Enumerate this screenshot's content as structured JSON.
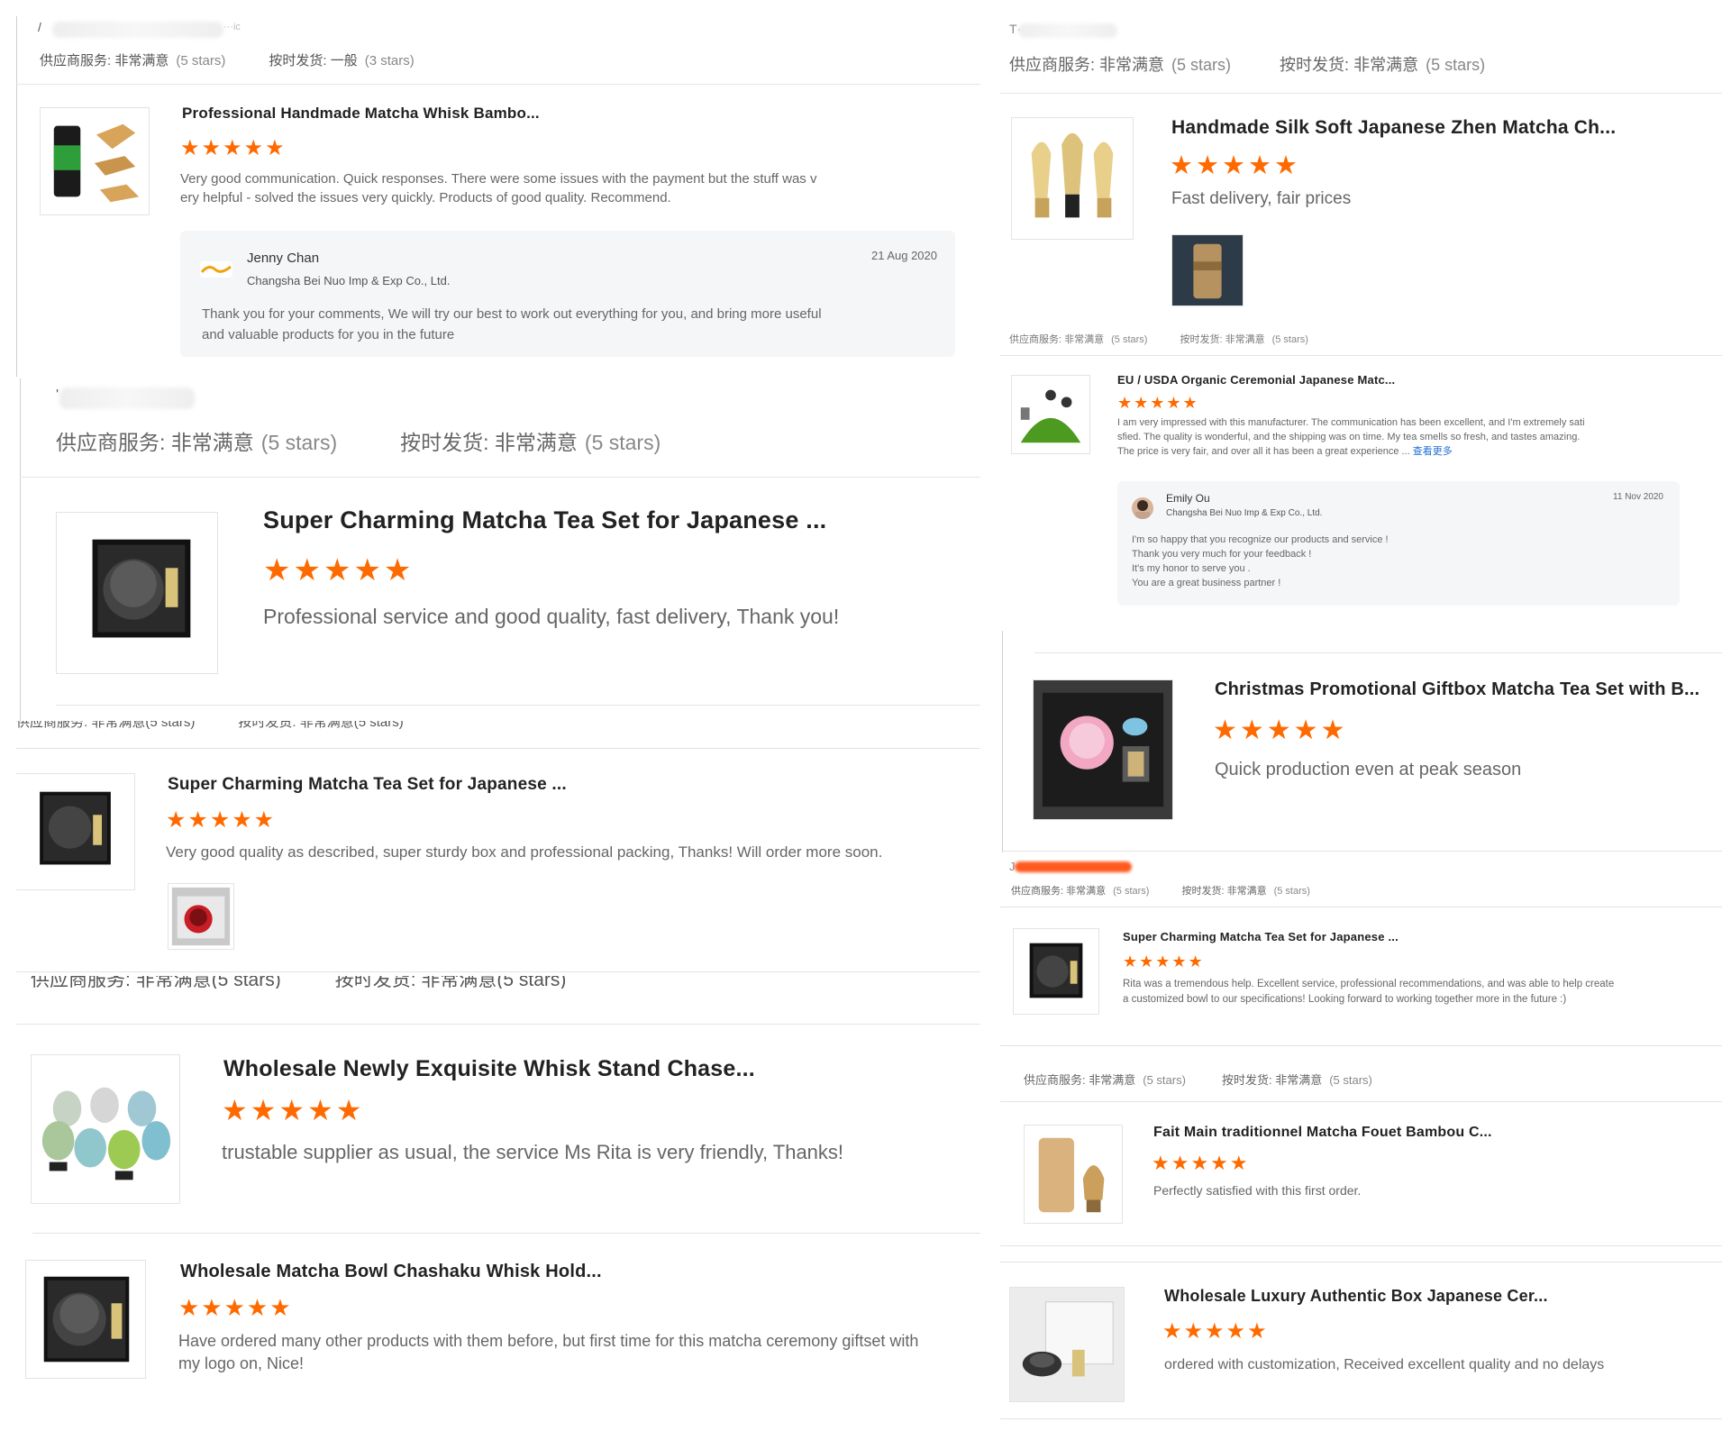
{
  "labels": {
    "service_label": "供应商服务:",
    "delivery_label": "按时发货:",
    "very_satisfied": "非常满意",
    "average": "一般",
    "five_stars": "(5 stars)",
    "three_stars": "(3 stars)",
    "stars_glyph": "★★★★★",
    "more_link": "查看更多"
  },
  "left": {
    "c1": {
      "name_fragment_a": "/",
      "name_fragment_b": "···ic",
      "product_title": "Professional Handmade Matcha Whisk Bambo...",
      "comment_line1": "Very good communication. Quick responses. There were some issues with the payment but the stuff was v",
      "comment_line2": "ery helpful - solved the issues very quickly. Products of good quality. Recommend.",
      "reply": {
        "name": "Jenny Chan",
        "company": "Changsha Bei Nuo Imp & Exp Co., Ltd.",
        "date": "21 Aug 2020",
        "line1": "Thank you for your comments, We will try our best to work out everything for you, and bring more useful",
        "line2": "and valuable products for you in the future"
      }
    },
    "c2": {
      "name_fragment": "'",
      "product_title": "Super Charming Matcha Tea Set for Japanese ...",
      "comment": "Professional service and good quality, fast delivery, Thank you!"
    },
    "c3": {
      "product_title": "Super Charming Matcha Tea Set for Japanese ...",
      "comment": "Very good quality as described, super sturdy box and professional packing, Thanks! Will order more soon."
    },
    "c4": {
      "product_title": "Wholesale Newly Exquisite Whisk Stand Chase...",
      "comment": "trustable supplier as usual, the service Ms Rita is very friendly, Thanks!"
    },
    "c5": {
      "product_title": "Wholesale Matcha Bowl Chashaku Whisk Hold...",
      "comment_line1": "Have ordered many other products with them before,  but first time for this matcha ceremony giftset with",
      "comment_line2": "my logo on, Nice!"
    }
  },
  "right": {
    "r1": {
      "name_fragment": "T···",
      "product_title": "Handmade Silk Soft Japanese Zhen Matcha Ch...",
      "comment": "Fast delivery, fair prices"
    },
    "r2": {
      "product_title": "EU / USDA Organic Ceremonial Japanese Matc...",
      "comment_line1": "I am very impressed with this manufacturer. The communication has been excellent, and I'm extremely sati",
      "comment_line2": "sfied. The quality is wonderful, and the shipping was on time. My tea smells so fresh, and tastes amazing.",
      "comment_line3": "The price is very fair, and over all it has been a great experience ...",
      "reply": {
        "name": "Emily Ou",
        "company": "Changsha Bei Nuo Imp & Exp Co., Ltd.",
        "date": "11 Nov 2020",
        "line1": "I'm so happy that you recognize our products and service !",
        "line2": "Thank you very much for your feedback !",
        "line3": "It's my honor to serve you .",
        "line4": "You are a great business partner !"
      }
    },
    "r3": {
      "product_title": "Christmas Promotional Giftbox Matcha Tea Set with B...",
      "comment": "Quick production even at peak season"
    },
    "r4": {
      "name_fragment": "J",
      "product_title": "Super Charming Matcha Tea Set for Japanese ...",
      "comment_line1": "Rita was a tremendous help. Excellent service, professional recommendations, and was able to help create",
      "comment_line2": "a customized bowl to our specifications! Looking forward to working together more in the future :)"
    },
    "r5": {
      "product_title": "Fait Main traditionnel Matcha Fouet Bambou C...",
      "comment": "Perfectly satisfied with this first order."
    },
    "r6": {
      "product_title": "Wholesale Luxury Authentic Box Japanese Cer...",
      "comment": "ordered with customization, Received excellent quality and no delays"
    }
  }
}
